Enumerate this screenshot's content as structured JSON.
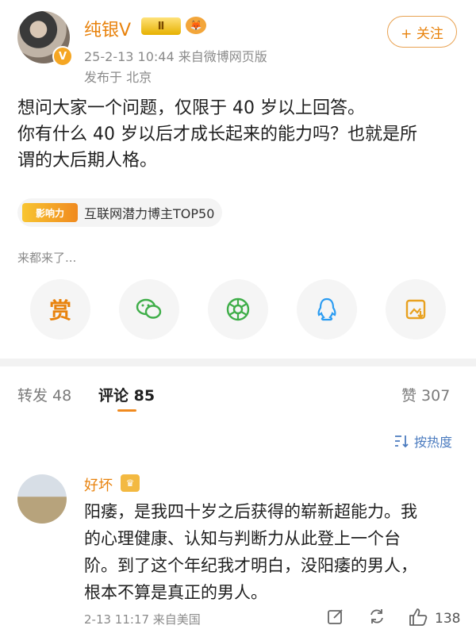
{
  "post": {
    "username": "纯银",
    "v_mark": "V",
    "vip_badge": "Ⅱ",
    "timestamp": "25-2-13 10:44",
    "source": "来自微博网页版",
    "location": "发布于 北京",
    "follow_label": "+ 关注",
    "text_lines": [
      "想问大家一个问题，仅限于 40 岁以上回答。",
      "你有什么 40 岁以后才成长起来的能力吗？也就是所",
      "谓的大后期人格。"
    ],
    "influence_logo_text": "影响力",
    "influence_tag": "互联网潜力博主TOP50",
    "come_text": "来都来了..."
  },
  "share": {
    "reward_label": "赏",
    "icons": [
      "reward-icon",
      "wechat-icon",
      "moments-icon",
      "qq-icon",
      "save-image-icon"
    ]
  },
  "tabs": {
    "repost": "转发 48",
    "comments": "评论 85",
    "likes": "赞 307"
  },
  "sort": {
    "label": "按热度"
  },
  "comment": {
    "username": "好坏",
    "text_lines": [
      "阳痿，是我四十岁之后获得的崭新超能力。我",
      "的心理健康、认知与判断力从此登上一个台",
      "阶。到了这个年纪我才明白，没阳痿的男人，",
      "根本不算是真正的男人。"
    ],
    "meta": "2-13 11:17 来自美国",
    "like_count": "138"
  },
  "colors": {
    "accent": "#e8820c",
    "link": "#4b7bbf"
  }
}
